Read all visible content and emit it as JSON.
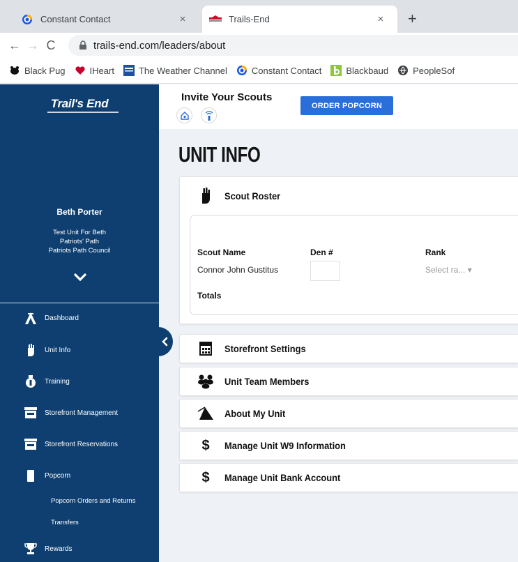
{
  "browser": {
    "tabs": [
      {
        "title": "Constant Contact",
        "icon": "constant-contact-icon"
      },
      {
        "title": "Trails-End",
        "icon": "trails-end-favicon"
      }
    ],
    "new_tab": "+",
    "close": "×",
    "url": "trails-end.com/leaders/about",
    "bookmarks": [
      {
        "label": "Black Pug",
        "icon": "pug-icon"
      },
      {
        "label": "IHeart",
        "icon": "iheart-icon"
      },
      {
        "label": "The Weather Channel",
        "icon": "weather-channel-icon"
      },
      {
        "label": "Constant Contact",
        "icon": "constant-contact-icon"
      },
      {
        "label": "Blackbaud",
        "icon": "blackbaud-icon"
      },
      {
        "label": "PeopleSof",
        "icon": "peoplesoft-icon"
      }
    ]
  },
  "sidebar": {
    "logo": "Trail's End",
    "user_name": "Beth Porter",
    "unit_lines": [
      "Test Unit For Beth",
      "Patriots' Path",
      "Patriots Path Council"
    ],
    "nav": [
      {
        "label": "Dashboard",
        "icon": "dashboard-tent-icon"
      },
      {
        "label": "Unit Info",
        "icon": "hand-icon"
      },
      {
        "label": "Training",
        "icon": "training-icon"
      },
      {
        "label": "Storefront Management",
        "icon": "storefront-icon"
      },
      {
        "label": "Storefront Reservations",
        "icon": "storefront-icon"
      },
      {
        "label": "Popcorn",
        "icon": "popcorn-icon"
      }
    ],
    "sub_nav": [
      "Popcorn Orders and Returns",
      "Transfers"
    ],
    "rewards": {
      "label": "Rewards",
      "icon": "trophy-icon"
    }
  },
  "topbar": {
    "invite_title": "Invite Your Scouts",
    "order_button": "ORDER POPCORN"
  },
  "main": {
    "page_title": "UNIT INFO",
    "roster": {
      "title": "Scout Roster",
      "columns": [
        "Scout Name",
        "Den #",
        "Rank"
      ],
      "rows": [
        {
          "name": "Connor John Gustitus",
          "den": "",
          "rank_placeholder": "Select ra... ▾"
        }
      ],
      "totals_label": "Totals"
    },
    "sections": [
      {
        "title": "Storefront Settings",
        "icon": "calculator-icon"
      },
      {
        "title": "Unit Team Members",
        "icon": "people-group-icon"
      },
      {
        "title": "About My Unit",
        "icon": "tent-icon"
      },
      {
        "title": "Manage Unit W9 Information",
        "icon": "dollar-icon"
      },
      {
        "title": "Manage Unit Bank Account",
        "icon": "dollar-icon"
      }
    ]
  },
  "colors": {
    "sidebar_bg": "#0e3f70",
    "button_blue": "#2a6fd9",
    "page_bg": "#eef1f6"
  }
}
